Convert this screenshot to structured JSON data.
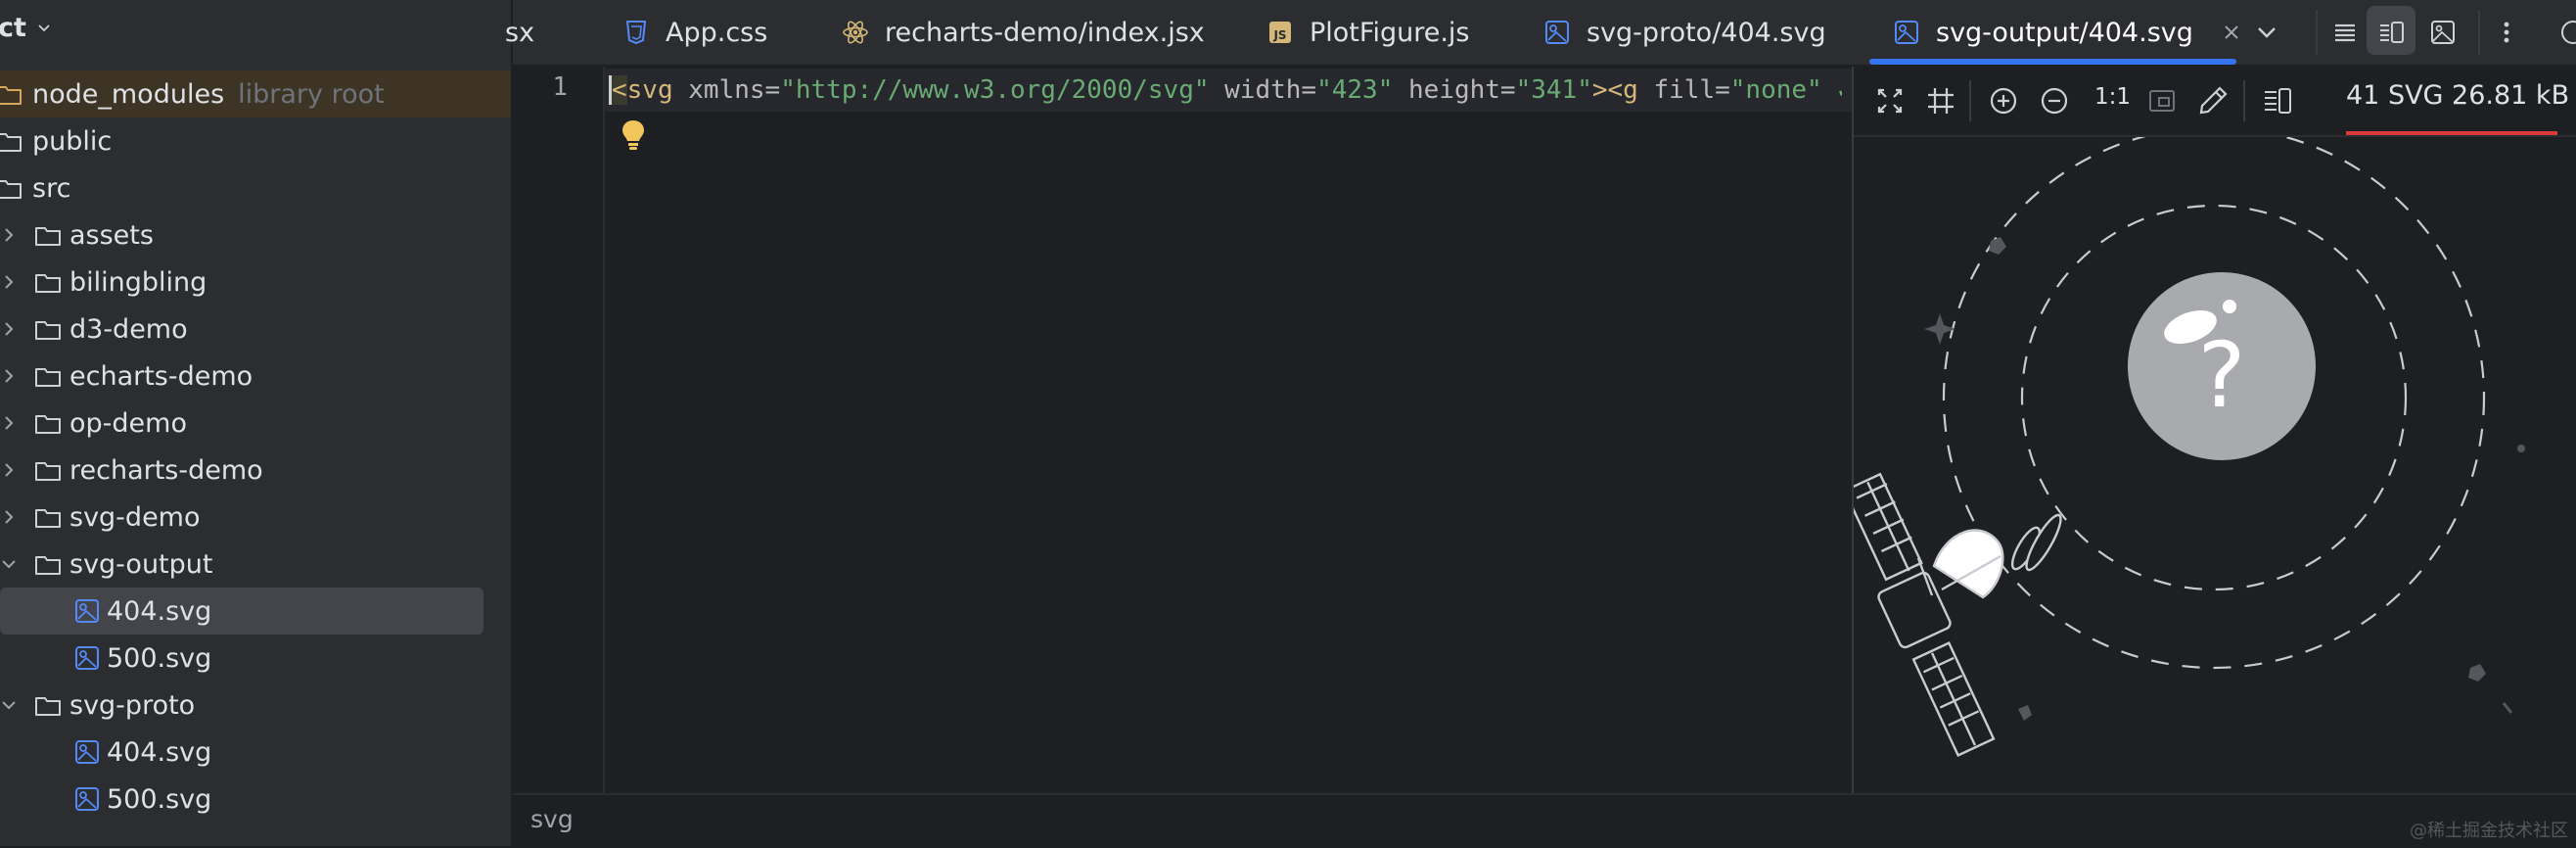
{
  "project": {
    "title": "ct"
  },
  "tree": {
    "items": [
      {
        "label": "node_modules",
        "hint": "library root"
      },
      {
        "label": "public"
      },
      {
        "label": "src"
      },
      {
        "label": "assets"
      },
      {
        "label": "bilingbling"
      },
      {
        "label": "d3-demo"
      },
      {
        "label": "echarts-demo"
      },
      {
        "label": "op-demo"
      },
      {
        "label": "recharts-demo"
      },
      {
        "label": "svg-demo"
      },
      {
        "label": "svg-output"
      },
      {
        "label": "404.svg"
      },
      {
        "label": "500.svg"
      },
      {
        "label": "svg-proto"
      },
      {
        "label": "404.svg"
      },
      {
        "label": "500.svg"
      }
    ]
  },
  "tabs": [
    {
      "label": "sx",
      "icon": "partial-tab"
    },
    {
      "label": "App.css",
      "icon": "css-file-icon"
    },
    {
      "label": "recharts-demo/index.jsx",
      "icon": "react-icon"
    },
    {
      "label": "PlotFigure.js",
      "icon": "js-file-icon"
    },
    {
      "label": "svg-proto/404.svg",
      "icon": "svg-file-icon"
    },
    {
      "label": "svg-output/404.svg",
      "icon": "svg-file-icon",
      "active": true
    }
  ],
  "editor": {
    "line_number": "1",
    "code": {
      "t1": "<",
      "t2": "svg",
      "a1": " xmlns=",
      "v1": "\"http://www.w3.org/2000/svg\"",
      "a2": " width=",
      "v2": "\"423\"",
      "a3": " height=",
      "v3": "\"341\"",
      "t3": "><g",
      "a4": " fill=",
      "v4": "\"none\"",
      "check": " ✓"
    }
  },
  "preview": {
    "zoom_label": "1:1",
    "file_info": "41 SVG 26.81 kB"
  },
  "status": {
    "breadcrumb": "svg"
  },
  "watermark": "@稀土掘金技术社区"
}
